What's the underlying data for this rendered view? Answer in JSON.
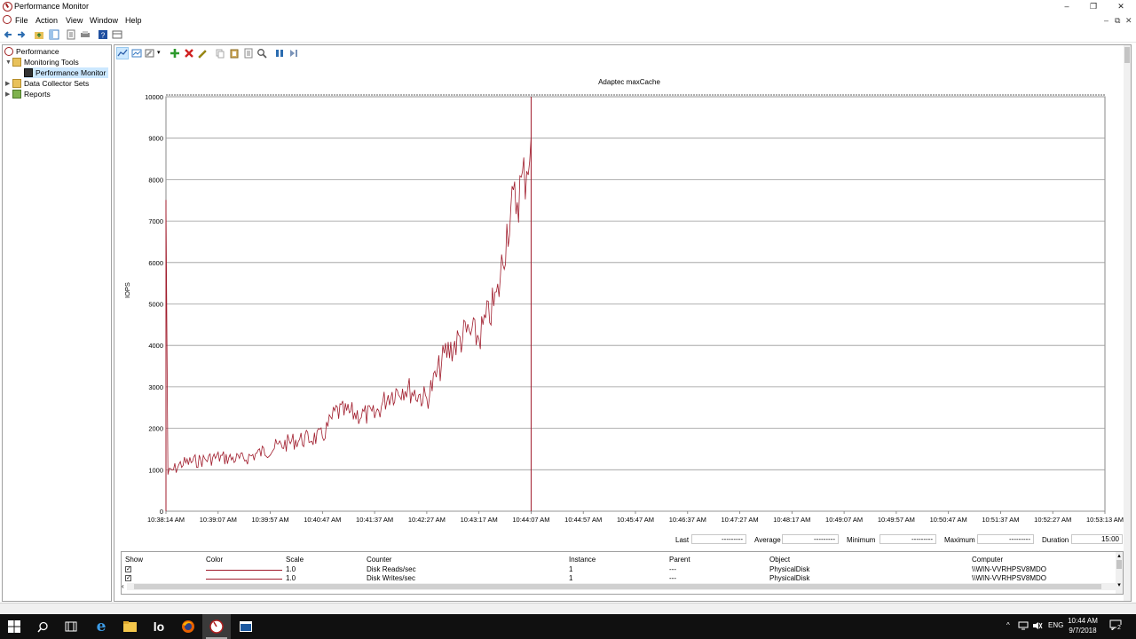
{
  "window": {
    "title": "Performance Monitor",
    "controls": [
      "–",
      "❐",
      "✕"
    ]
  },
  "menu": {
    "items": [
      "File",
      "Action",
      "View",
      "Window",
      "Help"
    ],
    "mdi_controls": [
      "–",
      "⧉",
      "✕"
    ]
  },
  "tree": {
    "root": "Performance",
    "monitoring_tools": "Monitoring Tools",
    "performance_monitor": "Performance Monitor",
    "data_collector_sets": "Data Collector Sets",
    "reports": "Reports"
  },
  "chart_data": {
    "type": "line",
    "title": "Adaptec maxCache",
    "ylabel": "IOPS",
    "ylim": [
      0,
      10000
    ],
    "yticks": [
      0,
      1000,
      2000,
      3000,
      4000,
      5000,
      6000,
      7000,
      8000,
      9000,
      10000
    ],
    "xticks": [
      "10:38:14 AM",
      "10:39:07 AM",
      "10:39:57 AM",
      "10:40:47 AM",
      "10:41:37 AM",
      "10:42:27 AM",
      "10:43:17 AM",
      "10:44:07 AM",
      "10:44:57 AM",
      "10:45:47 AM",
      "10:46:37 AM",
      "10:47:27 AM",
      "10:48:17 AM",
      "10:49:07 AM",
      "10:49:57 AM",
      "10:50:47 AM",
      "10:51:37 AM",
      "10:52:27 AM",
      "10:53:13 AM"
    ],
    "grid": true,
    "series": [
      {
        "name": "Disk Writes/sec",
        "color": "#a01c2c",
        "x": [
          "10:38:14 AM",
          "10:38:16 AM",
          "10:38:30 AM",
          "10:39:07 AM",
          "10:39:30 AM",
          "10:39:57 AM",
          "10:40:20 AM",
          "10:40:47 AM",
          "10:41:00 AM",
          "10:41:37 AM",
          "10:41:50 AM",
          "10:42:05 AM",
          "10:42:27 AM",
          "10:42:45 AM",
          "10:43:05 AM",
          "10:43:17 AM",
          "10:43:35 AM",
          "10:43:45 AM",
          "10:44:00 AM",
          "10:44:07 AM"
        ],
        "values": [
          7500,
          900,
          1150,
          1300,
          1250,
          1500,
          1700,
          1800,
          2400,
          2300,
          2800,
          3000,
          2700,
          3800,
          4300,
          4200,
          5200,
          7000,
          8000,
          9000
        ]
      }
    ]
  },
  "stats": {
    "last_label": "Last",
    "last_value": "---------",
    "average_label": "Average",
    "average_value": "---------",
    "minimum_label": "Minimum",
    "minimum_value": "---------",
    "maximum_label": "Maximum",
    "maximum_value": "---------",
    "duration_label": "Duration",
    "duration_value": "15:00"
  },
  "legend": {
    "headers": [
      "Show",
      "Color",
      "Scale",
      "Counter",
      "Instance",
      "Parent",
      "Object",
      "Computer"
    ],
    "rows": [
      {
        "show": "✓",
        "scale": "1.0",
        "counter": "Disk Reads/sec",
        "instance": "1",
        "parent": "---",
        "object": "PhysicalDisk",
        "computer": "\\\\WIN-VVRHPSV8MDO"
      },
      {
        "show": "✓",
        "scale": "1.0",
        "counter": "Disk Writes/sec",
        "instance": "1",
        "parent": "---",
        "object": "PhysicalDisk",
        "computer": "\\\\WIN-VVRHPSV8MDO"
      }
    ]
  },
  "taskbar": {
    "apps": [
      "windows-start",
      "search",
      "task-view",
      "edge",
      "file-explorer",
      "lo",
      "firefox",
      "performance-monitor",
      "app"
    ],
    "lo_label": "lo",
    "tray": {
      "lang": "ENG",
      "chevron": "^"
    },
    "clock_time": "10:44 AM",
    "clock_date": "9/7/2018",
    "notifications": "2"
  }
}
